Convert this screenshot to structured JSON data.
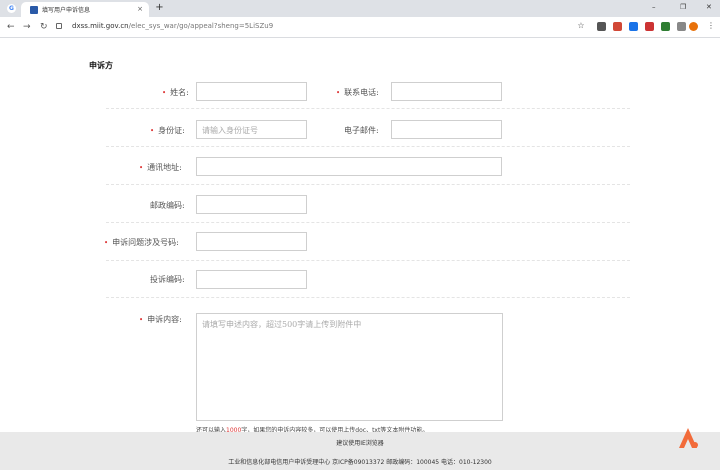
{
  "browser": {
    "tab_title": "填写用户申诉信息",
    "url_host": "dxss.miit.gov.cn",
    "url_path": "/elec_sys_war/go/appeal?sheng=5LiSZu9",
    "google_letter": "G",
    "close_glyph": "×",
    "newtab_glyph": "+",
    "back_glyph": "←",
    "forward_glyph": "→",
    "reload_glyph": "↻",
    "minimize_glyph": "–",
    "maximize_glyph": "❐",
    "window_close_glyph": "✕",
    "star_glyph": "☆",
    "menu_glyph": "⋮",
    "ext_colors": [
      "#555555",
      "#d14836",
      "#1a73e8",
      "#cc3333",
      "#2e7d32",
      "#888888",
      "#e8710a"
    ]
  },
  "form": {
    "section_title": "申诉方",
    "name_label": "姓名:",
    "phone_label": "联系电话:",
    "id_label": "身份证:",
    "id_placeholder": "请输入身份证号",
    "email_label": "电子邮件:",
    "address_label": "通讯地址:",
    "postcode_label": "邮政编码:",
    "problem_number_label": "申诉问题涉及号码:",
    "complaint_code_label": "投诉编码:",
    "content_label": "申诉内容:",
    "content_placeholder": "请填写申述内容，超过500字请上传到附件中",
    "required_mark": "•",
    "hint_prefix": "还可以输入",
    "hint_count": "1000",
    "hint_suffix": "字，如果您的申诉内容较多，可以使用上传doc、txt等文本附件功能。"
  },
  "footer": {
    "browser_note": "建议使用IE浏览器",
    "copyright": "工业和信息化部电信用户申诉受理中心  京ICP备09013372  邮政编码：100045  电话：010-12300"
  },
  "colors": {
    "required": "#dd3333",
    "footer_bg": "#e9e9e9",
    "logo": "#f26b3a"
  }
}
